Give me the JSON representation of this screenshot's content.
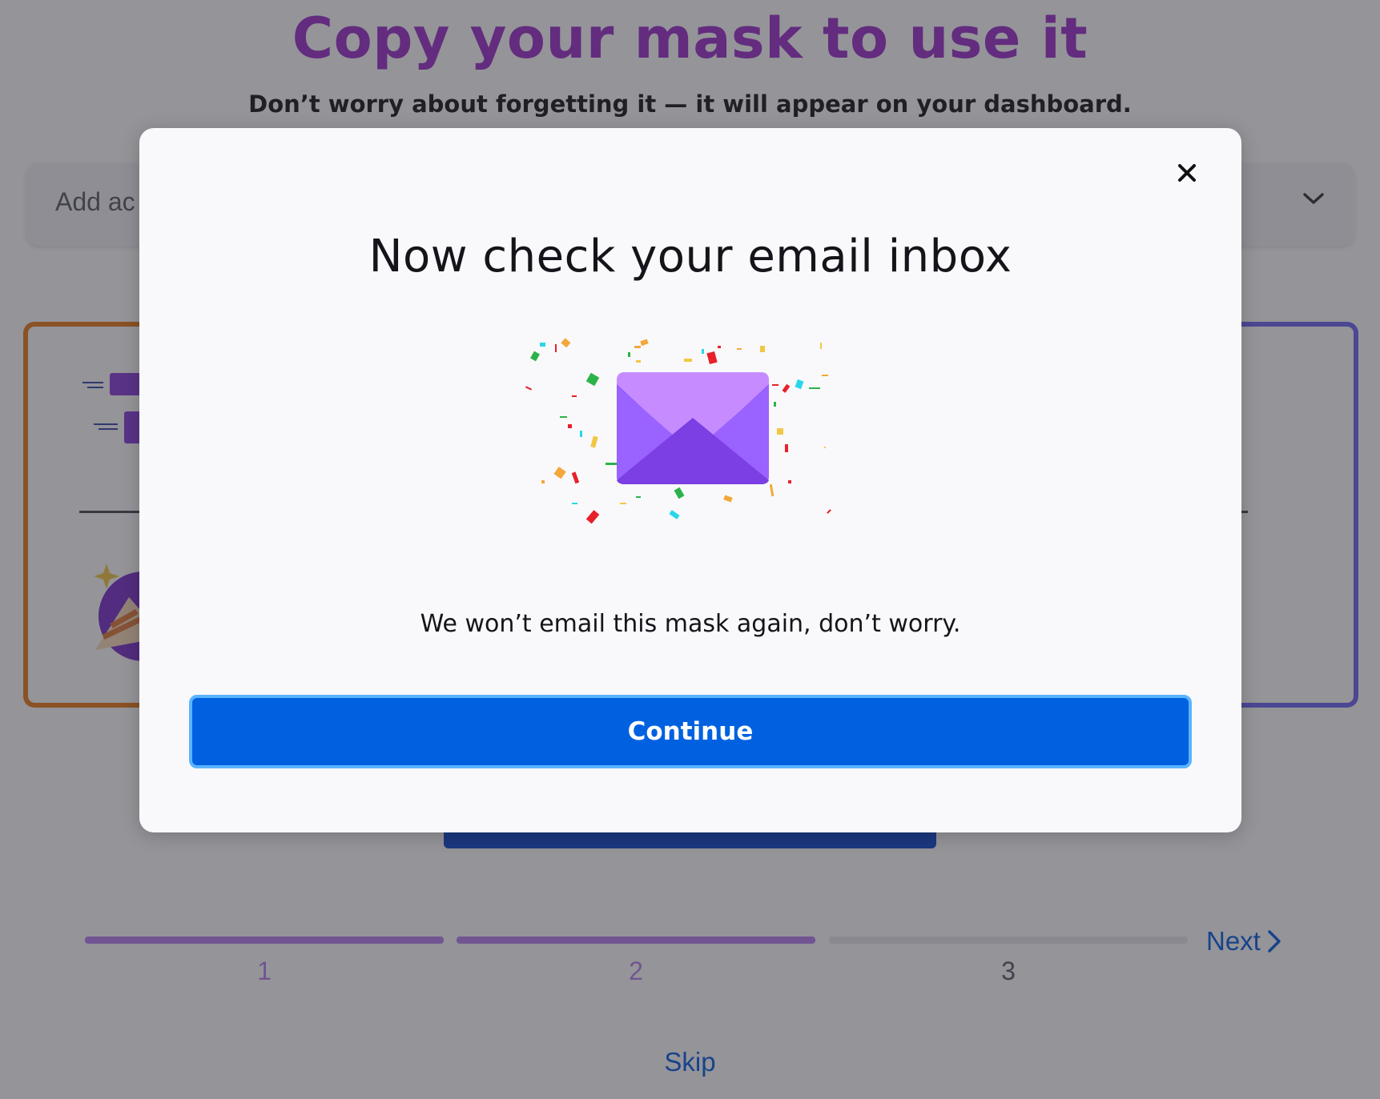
{
  "onboarding": {
    "title": "Copy your mask to use it",
    "subtitle": "Don’t worry about forgetting it — it will appear on your dashboard.",
    "domain_select": {
      "placeholder": "Add ac"
    },
    "steps": [
      {
        "label": "1",
        "state": "complete"
      },
      {
        "label": "2",
        "state": "complete"
      },
      {
        "label": "3",
        "state": "upcoming"
      }
    ],
    "next_label": "Next",
    "skip_label": "Skip"
  },
  "modal": {
    "title": "Now check your email inbox",
    "message": "We won’t email this mask again, don’t worry.",
    "continue_label": "Continue",
    "illustration": "envelope-confetti-icon"
  },
  "colors": {
    "title": "#9b2fc9",
    "button": "#0061e0",
    "button_border": "#5ab4ff",
    "envelope": "#9059ff",
    "progress_done": "#b97ff0",
    "progress_todo": "#e6e6ea",
    "card_left_border": "#e87b1a",
    "card_right_border": "#6e64f0"
  }
}
